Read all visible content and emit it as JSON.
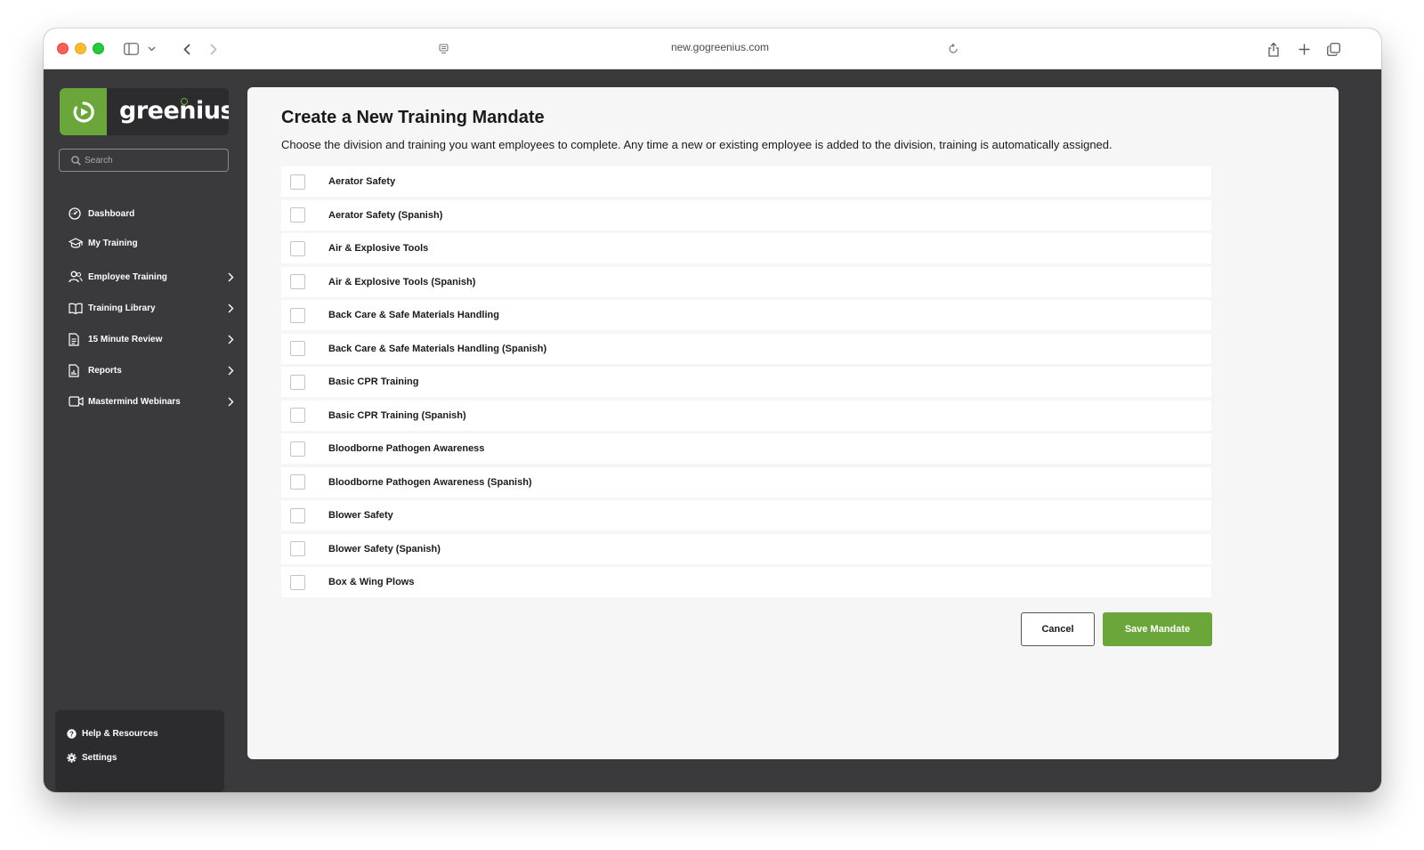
{
  "browser": {
    "url": "new.gogreenius.com"
  },
  "brand": {
    "name": "greenius",
    "accent_color": "#6aa63a"
  },
  "search": {
    "placeholder": "Search"
  },
  "nav": {
    "items": [
      {
        "label": "Dashboard",
        "icon": "dashboard-icon",
        "has_submenu": false
      },
      {
        "label": "My Training",
        "icon": "graduation-cap-icon",
        "has_submenu": false
      },
      {
        "label": "Employee Training",
        "icon": "users-icon",
        "has_submenu": true
      },
      {
        "label": "Training Library",
        "icon": "book-icon",
        "has_submenu": true
      },
      {
        "label": "15 Minute Review",
        "icon": "document-icon",
        "has_submenu": true
      },
      {
        "label": "Reports",
        "icon": "report-icon",
        "has_submenu": true
      },
      {
        "label": "Mastermind Webinars",
        "icon": "video-icon",
        "has_submenu": true
      }
    ]
  },
  "bottom": {
    "help_label": "Help & Resources",
    "settings_label": "Settings"
  },
  "main": {
    "title": "Create a New Training Mandate",
    "description": "Choose the division and training you want employees to complete. Any time a new or existing employee is added to the division, training is automatically assigned.",
    "trainings": [
      {
        "label": "Aerator Safety",
        "checked": false
      },
      {
        "label": "Aerator Safety (Spanish)",
        "checked": false
      },
      {
        "label": "Air & Explosive Tools",
        "checked": false
      },
      {
        "label": "Air & Explosive Tools (Spanish)",
        "checked": false
      },
      {
        "label": "Back Care & Safe Materials Handling",
        "checked": false
      },
      {
        "label": "Back Care & Safe Materials Handling (Spanish)",
        "checked": false
      },
      {
        "label": "Basic CPR Training",
        "checked": false
      },
      {
        "label": "Basic CPR Training (Spanish)",
        "checked": false
      },
      {
        "label": "Bloodborne Pathogen Awareness",
        "checked": false
      },
      {
        "label": "Bloodborne Pathogen Awareness (Spanish)",
        "checked": false
      },
      {
        "label": "Blower Safety",
        "checked": false
      },
      {
        "label": "Blower Safety (Spanish)",
        "checked": false
      },
      {
        "label": "Box & Wing Plows",
        "checked": false
      }
    ],
    "cancel_label": "Cancel",
    "save_label": "Save Mandate"
  }
}
